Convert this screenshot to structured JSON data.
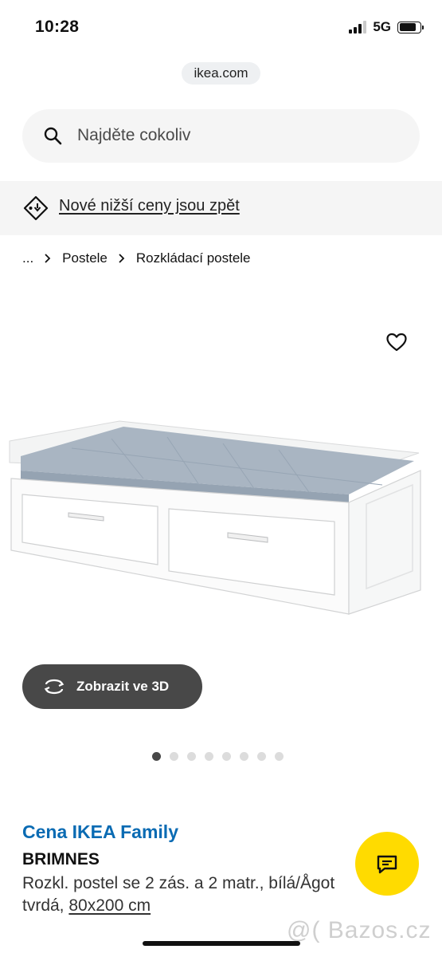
{
  "status": {
    "time": "10:28",
    "network": "5G",
    "battery_fraction": 0.85
  },
  "browser": {
    "url": "ikea.com"
  },
  "search": {
    "placeholder": "Najděte cokoliv",
    "icon": "search-icon"
  },
  "promo": {
    "text": "Nové nižší ceny jsou zpět",
    "icon": "price-tag-icon"
  },
  "breadcrumb": {
    "items": [
      "...",
      "Postele",
      "Rozkládací postele"
    ]
  },
  "gallery": {
    "image_count": 8,
    "active_index": 0,
    "favorite_icon": "heart-icon"
  },
  "view3d": {
    "label": "Zobrazit ve 3D",
    "icon": "rotate-3d-icon"
  },
  "product": {
    "price_label": "Cena IKEA Family",
    "name": "BRIMNES",
    "description": "Rozkl. postel se 2 zás. a 2 matr., bílá/Ågot",
    "description_2": "tvrdá,",
    "size": "80x200 cm"
  },
  "chat": {
    "icon": "chat-icon"
  },
  "watermark": "@( Bazos.cz",
  "colors": {
    "family_blue": "#0a6bb3",
    "chat_yellow": "#ffdb00",
    "button_dark": "#484848"
  }
}
